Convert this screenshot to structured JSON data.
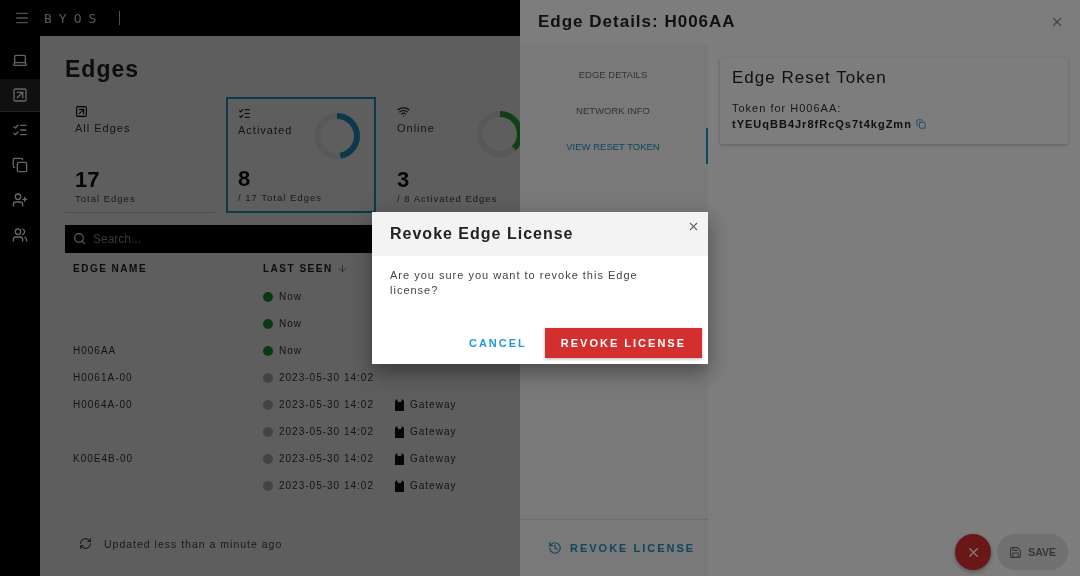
{
  "app": {
    "logo": "BYOS"
  },
  "sidebar": [
    {
      "kind": "laptop",
      "selected": false
    },
    {
      "kind": "edge",
      "selected": true
    },
    {
      "kind": "list",
      "selected": false
    },
    {
      "kind": "copy",
      "selected": false
    },
    {
      "kind": "user-add",
      "selected": false
    },
    {
      "kind": "group",
      "selected": false
    }
  ],
  "page": {
    "title": "Edges"
  },
  "cards": [
    {
      "kind": "all",
      "label": "All Edges",
      "value": "17",
      "caption": "Total Edges",
      "selected": false
    },
    {
      "kind": "activated",
      "label": "Activated",
      "value": "8",
      "caption": "/ 17 Total Edges",
      "selected": true,
      "level": 0.47
    },
    {
      "kind": "online",
      "label": "Online",
      "value": "3",
      "caption": "/ 8 Activated Edges",
      "selected": false,
      "level": 0.375
    }
  ],
  "search": {
    "placeholder": "Search..."
  },
  "table": {
    "columns": [
      {
        "label": "EDGE NAME",
        "sorted": false
      },
      {
        "label": "LAST SEEN",
        "sorted": true
      }
    ],
    "rows": [
      {
        "last_seen": "Now",
        "online": true
      },
      {
        "last_seen": "Now",
        "online": true
      },
      {
        "name": "H006AA",
        "last_seen": "Now",
        "online": true
      },
      {
        "name": "H0061A-00",
        "last_seen": "2023-05-30 14:02",
        "online": false
      },
      {
        "name": "H0064A-00",
        "last_seen": "2023-05-30 14:02",
        "online": false,
        "type": "Gateway"
      },
      {
        "last_seen": "2023-05-30 14:02",
        "online": false,
        "type": "Gateway"
      },
      {
        "name": "K00E4B-00",
        "last_seen": "2023-05-30 14:02",
        "online": false,
        "type": "Gateway"
      },
      {
        "last_seen": "2023-05-30 14:02",
        "online": false,
        "type": "Gateway"
      }
    ]
  },
  "status": "Updated less than a minute ago",
  "drawer": {
    "title": "Edge Details: H006AA",
    "nav": [
      {
        "label": "EDGE DETAILS",
        "selected": false
      },
      {
        "label": "NETWORK INFO",
        "selected": false
      },
      {
        "label": "VIEW RESET TOKEN",
        "selected": true
      }
    ],
    "revoke": "REVOKE LICENSE",
    "token_card": {
      "title": "Edge Reset Token",
      "label": "Token for H006AA:",
      "token": "tYEUqBB4Jr8fRcQs7t4kgZmn"
    },
    "save": {
      "label": "SAVE",
      "disabled": true
    }
  },
  "dialog": {
    "title": "Revoke Edge License",
    "message": "Are you sure you want to revoke this Edge license?",
    "cancel": "CANCEL",
    "confirm": "REVOKE LICENSE"
  }
}
